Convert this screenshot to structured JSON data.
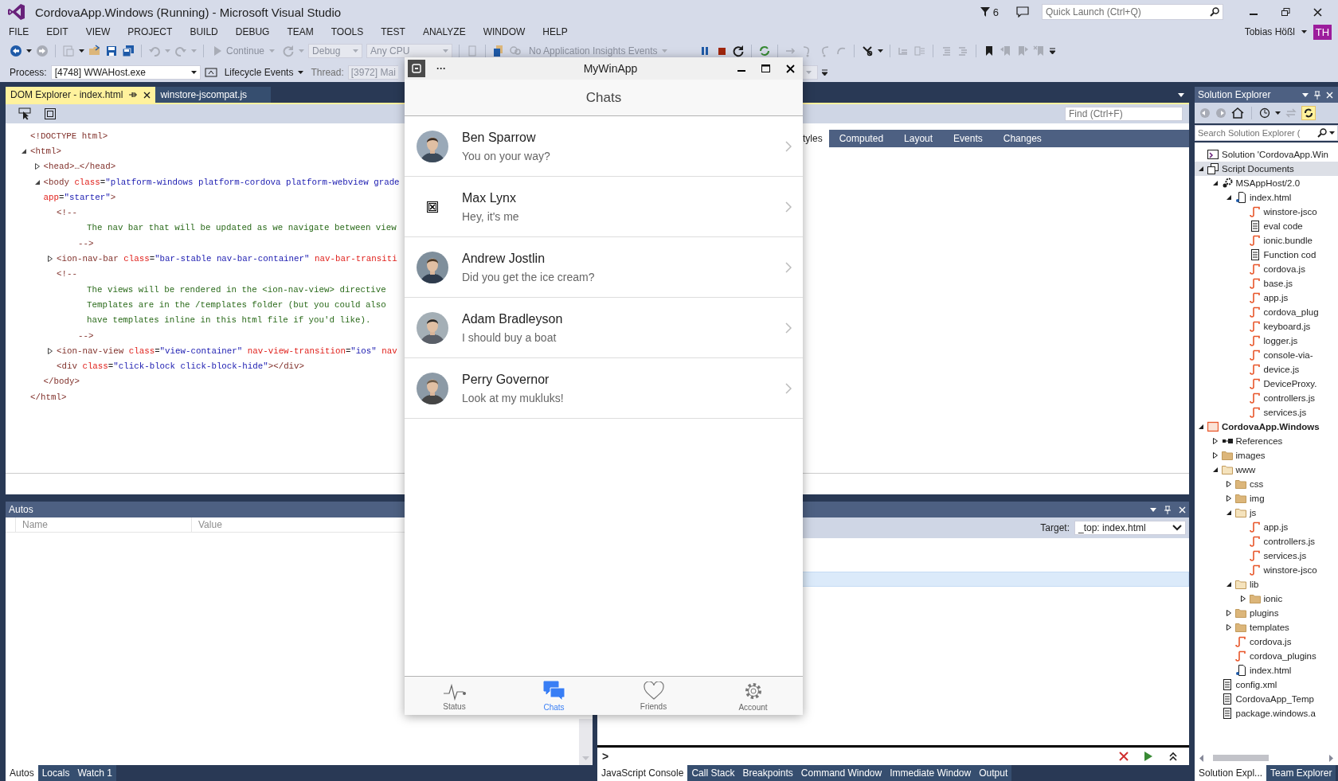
{
  "window": {
    "title": "CordovaApp.Windows (Running) - Microsoft Visual Studio",
    "notification_count": "6",
    "quick_launch_placeholder": "Quick Launch (Ctrl+Q)",
    "user": "Tobias Hößl",
    "user_initials": "TH"
  },
  "menu": [
    "FILE",
    "EDIT",
    "VIEW",
    "PROJECT",
    "BUILD",
    "DEBUG",
    "TEAM",
    "TOOLS",
    "TEST",
    "ANALYZE",
    "WINDOW",
    "HELP"
  ],
  "toolbar": {
    "continue": "Continue",
    "configuration": "Debug",
    "platform": "Any CPU",
    "insights": "No Application Insights Events"
  },
  "debug_location": {
    "process_label": "Process:",
    "process": "[4748] WWAHost.exe",
    "lifecycle": "Lifecycle Events",
    "thread_label": "Thread:",
    "thread": "[3972] Mai"
  },
  "document_tabs": [
    {
      "label": "DOM Explorer - index.html",
      "selected": true
    },
    {
      "label": "winstore-jscompat.js",
      "selected": false
    }
  ],
  "dom_explorer": {
    "find_placeholder": "Find (Ctrl+F)",
    "tree": [
      {
        "lines": [
          [
            {
              "kind": "tag",
              "text": "<!DOCTYPE html>"
            }
          ]
        ]
      },
      {
        "lines": [
          [
            {
              "kind": "tag",
              "text": "<html>"
            }
          ]
        ],
        "expanded": true,
        "children": [
          {
            "lines": [
              [
                {
                  "kind": "tag",
                  "text": "<head>…</head>"
                }
              ]
            ],
            "expanded": false
          },
          {
            "lines": [
              [
                {
                  "kind": "tag",
                  "text": "<body"
                },
                {
                  "kind": "attr",
                  "text": " class"
                },
                {
                  "kind": "punct",
                  "text": "="
                },
                {
                  "kind": "value",
                  "text": "\"platform-windows platform-cordova platform-webview grade"
                }
              ],
              [
                {
                  "kind": "attr",
                  "text": "app"
                },
                {
                  "kind": "punct",
                  "text": "="
                },
                {
                  "kind": "value",
                  "text": "\"starter\""
                },
                {
                  "kind": "tag",
                  "text": ">"
                }
              ]
            ],
            "expanded": true,
            "children": [
              {
                "kind": "comment",
                "lines": [
                  [
                    {
                      "kind": "tag",
                      "text": "<!--"
                    }
                  ],
                  [
                    {
                      "kind": "comment",
                      "text": "The nav bar that will be updated as we navigate between view"
                    }
                  ],
                  [
                    {
                      "kind": "tag",
                      "text": "-->"
                    }
                  ]
                ]
              },
              {
                "lines": [
                  [
                    {
                      "kind": "tag",
                      "text": "<ion-nav-bar"
                    },
                    {
                      "kind": "attr",
                      "text": " class"
                    },
                    {
                      "kind": "punct",
                      "text": "="
                    },
                    {
                      "kind": "value",
                      "text": "\"bar-stable nav-bar-container\""
                    },
                    {
                      "kind": "attr",
                      "text": " nav-bar-transiti"
                    }
                  ]
                ],
                "expanded": false
              },
              {
                "kind": "comment",
                "lines": [
                  [
                    {
                      "kind": "tag",
                      "text": "<!--"
                    }
                  ],
                  [
                    {
                      "kind": "comment",
                      "text": "The views will be rendered in the <ion-nav-view> directive"
                    }
                  ],
                  [
                    {
                      "kind": "comment",
                      "text": "Templates are in the /templates folder (but you could also"
                    }
                  ],
                  [
                    {
                      "kind": "comment",
                      "text": "have templates inline in this html file if you'd like)."
                    }
                  ],
                  [
                    {
                      "kind": "tag",
                      "text": "-->"
                    }
                  ]
                ]
              },
              {
                "lines": [
                  [
                    {
                      "kind": "tag",
                      "text": "<ion-nav-view"
                    },
                    {
                      "kind": "attr",
                      "text": " class"
                    },
                    {
                      "kind": "punct",
                      "text": "="
                    },
                    {
                      "kind": "value",
                      "text": "\"view-container\""
                    },
                    {
                      "kind": "attr",
                      "text": " nav-view-transition"
                    },
                    {
                      "kind": "punct",
                      "text": "="
                    },
                    {
                      "kind": "value",
                      "text": "\"ios\""
                    },
                    {
                      "kind": "attr",
                      "text": " nav"
                    }
                  ]
                ],
                "expanded": false
              },
              {
                "lines": [
                  [
                    {
                      "kind": "tag",
                      "text": "<div"
                    },
                    {
                      "kind": "attr",
                      "text": " class"
                    },
                    {
                      "kind": "punct",
                      "text": "="
                    },
                    {
                      "kind": "value",
                      "text": "\"click-block click-block-hide\""
                    },
                    {
                      "kind": "tag",
                      "text": "></div>"
                    }
                  ]
                ]
              }
            ],
            "close": [
              {
                "kind": "tag",
                "text": "</body>"
              }
            ]
          }
        ],
        "close": [
          {
            "kind": "tag",
            "text": "</html>"
          }
        ]
      }
    ],
    "style_tabs": [
      {
        "label": "tyles",
        "selected": true
      },
      {
        "label": "Computed",
        "selected": false
      },
      {
        "label": "Layout",
        "selected": false
      },
      {
        "label": "Events",
        "selected": false
      },
      {
        "label": "Changes",
        "selected": false
      }
    ]
  },
  "autos": {
    "title": "Autos",
    "columns": [
      "Name",
      "Value"
    ],
    "tabs": [
      {
        "label": "Autos",
        "selected": true
      },
      {
        "label": "Locals",
        "selected": false
      },
      {
        "label": "Watch 1",
        "selected": false
      }
    ]
  },
  "console": {
    "target_label": "Target:",
    "target": "_top: index.html",
    "prompt": ">",
    "tabs": [
      {
        "label": "JavaScript Console",
        "selected": true
      },
      {
        "label": "Call Stack",
        "selected": false
      },
      {
        "label": "Breakpoints",
        "selected": false
      },
      {
        "label": "Command Window",
        "selected": false
      },
      {
        "label": "Immediate Window",
        "selected": false
      },
      {
        "label": "Output",
        "selected": false
      }
    ]
  },
  "solution_explorer": {
    "title": "Solution Explorer",
    "search_placeholder": "Search Solution Explorer (",
    "tree": [
      {
        "label": "Solution 'CordovaApp.Win",
        "kind": "solution",
        "selected": false
      },
      {
        "label": "Script Documents",
        "kind": "group",
        "selected": true,
        "expanded": true,
        "children": [
          {
            "label": "MSAppHost/2.0",
            "kind": "host",
            "selected": false,
            "expanded": true,
            "children": [
              {
                "label": "index.html",
                "kind": "html",
                "selected": false,
                "expanded": true,
                "children": [
                  {
                    "label": "winstore-jsco",
                    "kind": "script",
                    "selected": false
                  },
                  {
                    "label": "eval code",
                    "kind": "page",
                    "selected": false
                  },
                  {
                    "label": "ionic.bundle",
                    "kind": "script",
                    "selected": false
                  },
                  {
                    "label": "Function cod",
                    "kind": "page",
                    "selected": false
                  },
                  {
                    "label": "cordova.js",
                    "kind": "script",
                    "selected": false
                  },
                  {
                    "label": "base.js",
                    "kind": "script",
                    "selected": false
                  },
                  {
                    "label": "app.js",
                    "kind": "script",
                    "selected": false
                  },
                  {
                    "label": "cordova_plug",
                    "kind": "script",
                    "selected": false
                  },
                  {
                    "label": "keyboard.js",
                    "kind": "script",
                    "selected": false
                  },
                  {
                    "label": "logger.js",
                    "kind": "script",
                    "selected": false
                  },
                  {
                    "label": "console-via-",
                    "kind": "script",
                    "selected": false
                  },
                  {
                    "label": "device.js",
                    "kind": "script",
                    "selected": false
                  },
                  {
                    "label": "DeviceProxy.",
                    "kind": "script",
                    "selected": false
                  },
                  {
                    "label": "controllers.js",
                    "kind": "script",
                    "selected": false
                  },
                  {
                    "label": "services.js",
                    "kind": "script",
                    "selected": false
                  }
                ]
              }
            ]
          }
        ]
      },
      {
        "label": "CordovaApp.Windows",
        "kind": "project",
        "selected": false,
        "expanded": true,
        "children": [
          {
            "label": "References",
            "kind": "references",
            "selected": false,
            "expanded": false
          },
          {
            "label": "images",
            "kind": "folder",
            "selected": false,
            "expanded": false
          },
          {
            "label": "www",
            "kind": "folder",
            "selected": false,
            "expanded": true,
            "children": [
              {
                "label": "css",
                "kind": "folder",
                "selected": false,
                "expanded": false
              },
              {
                "label": "img",
                "kind": "folder",
                "selected": false,
                "expanded": false
              },
              {
                "label": "js",
                "kind": "folder",
                "selected": false,
                "expanded": true,
                "children": [
                  {
                    "label": "app.js",
                    "kind": "script",
                    "selected": false
                  },
                  {
                    "label": "controllers.js",
                    "kind": "script",
                    "selected": false
                  },
                  {
                    "label": "services.js",
                    "kind": "script",
                    "selected": false
                  },
                  {
                    "label": "winstore-jsco",
                    "kind": "script",
                    "selected": false
                  }
                ]
              },
              {
                "label": "lib",
                "kind": "folder",
                "selected": false,
                "expanded": true,
                "children": [
                  {
                    "label": "ionic",
                    "kind": "folder",
                    "selected": false,
                    "expanded": false
                  }
                ]
              },
              {
                "label": "plugins",
                "kind": "folder",
                "selected": false,
                "expanded": false
              },
              {
                "label": "templates",
                "kind": "folder",
                "selected": false,
                "expanded": false
              },
              {
                "label": "cordova.js",
                "kind": "script",
                "selected": false
              },
              {
                "label": "cordova_plugins",
                "kind": "script",
                "selected": false
              },
              {
                "label": "index.html",
                "kind": "html",
                "selected": false
              }
            ]
          },
          {
            "label": "config.xml",
            "kind": "config",
            "selected": false
          },
          {
            "label": "CordovaApp_Temp",
            "kind": "template",
            "selected": false
          },
          {
            "label": "package.windows.a",
            "kind": "manifest",
            "selected": false
          }
        ]
      }
    ],
    "tabs": [
      {
        "label": "Solution Expl...",
        "selected": true
      },
      {
        "label": "Team Explorer",
        "selected": false
      }
    ]
  },
  "app_window": {
    "title": "MyWinApp",
    "menu": "···",
    "header": "Chats",
    "chats": [
      {
        "name": "Ben Sparrow",
        "message": "You on your way?"
      },
      {
        "name": "Max Lynx",
        "message": "Hey, it's me",
        "kind": "missing"
      },
      {
        "name": "Andrew Jostlin",
        "message": "Did you get the ice cream?"
      },
      {
        "name": "Adam Bradleyson",
        "message": "I should buy a boat"
      },
      {
        "name": "Perry Governor",
        "message": "Look at my mukluks!"
      }
    ],
    "tabs": [
      {
        "label": "Status",
        "kind": "pulse",
        "selected": false
      },
      {
        "label": "Chats",
        "kind": "chats",
        "selected": true
      },
      {
        "label": "Friends",
        "kind": "heart",
        "selected": false
      },
      {
        "label": "Account",
        "kind": "gear",
        "selected": false
      }
    ]
  }
}
